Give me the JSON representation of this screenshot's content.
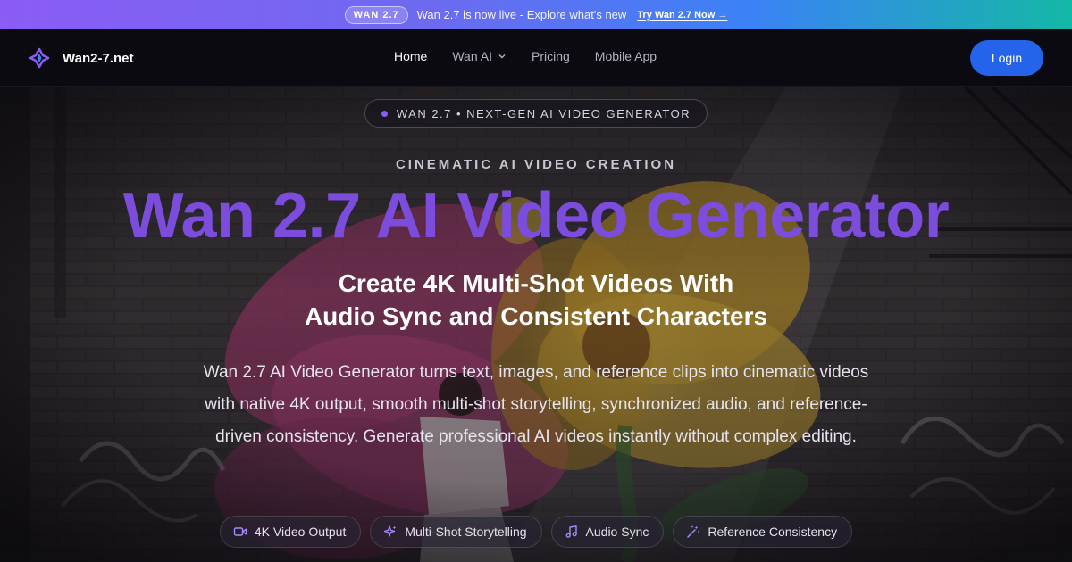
{
  "announcement": {
    "badge": "WAN 2.7",
    "text": "Wan 2.7 is now live - Explore what's new",
    "cta": "Try Wan 2.7 Now →"
  },
  "nav": {
    "brand": "Wan2-7.net",
    "links": [
      {
        "label": "Home"
      },
      {
        "label": "Wan AI"
      },
      {
        "label": "Pricing"
      },
      {
        "label": "Mobile App"
      }
    ],
    "login": "Login"
  },
  "hero": {
    "eyebrow": "WAN 2.7 • NEXT-GEN AI VIDEO GENERATOR",
    "kicker": "CINEMATIC AI VIDEO CREATION",
    "title": "Wan 2.7 AI Video Generator",
    "subtitle_line1": "Create 4K Multi-Shot Videos With",
    "subtitle_line2": "Audio Sync and Consistent Characters",
    "description": "Wan 2.7 AI Video Generator turns text, images, and reference clips into cinematic videos with native 4K output, smooth multi-shot storytelling, synchronized audio, and reference-driven consistency. Generate professional AI videos instantly without complex editing.",
    "features": [
      {
        "label": "4K Video Output",
        "icon": "video-camera-icon"
      },
      {
        "label": "Multi-Shot Storytelling",
        "icon": "sparkles-icon"
      },
      {
        "label": "Audio Sync",
        "icon": "music-note-icon"
      },
      {
        "label": "Reference Consistency",
        "icon": "magic-wand-icon"
      }
    ]
  },
  "colors": {
    "accent": "#7c4ddc",
    "login_bg": "#2563eb",
    "dot": "#8b5cf6"
  }
}
